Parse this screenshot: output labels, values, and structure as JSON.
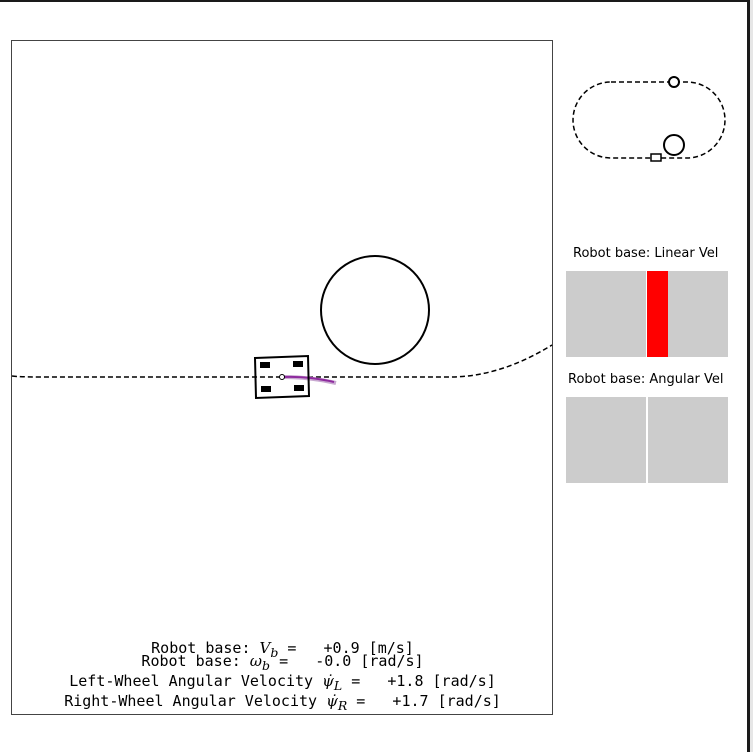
{
  "main_view": {
    "path_style": "dashed",
    "robot_trail_color": "#8e2a9e",
    "obstacle_label": ""
  },
  "mini_map": {
    "track_style": "dashed"
  },
  "gauges": {
    "linear": {
      "title": "Robot base: Linear Vel",
      "value_fraction": 0.13,
      "fill_color": "#ff0000"
    },
    "angular": {
      "title": "Robot base: Angular Vel",
      "value_fraction": 0.0,
      "fill_color": "#ff0000"
    },
    "background_color": "#cccccc"
  },
  "readouts": {
    "linear": {
      "prefix": "Robot base: ",
      "symbol": "V",
      "sub": "b",
      "value": "  +0.9 [m/s]"
    },
    "angular": {
      "prefix": "Robot base: ",
      "symbol": "ω",
      "sub": "b",
      "value": "  -0.0 [rad/s]"
    },
    "left_wheel": {
      "prefix": "Left-Wheel Angular Velocity ",
      "symbol": "ψ̇",
      "sub": "L",
      "value": "  +1.8 [rad/s]"
    },
    "right_wheel": {
      "prefix": "Right-Wheel Angular Velocity ",
      "symbol": "ψ̇",
      "sub": "R",
      "value": "  +1.7 [rad/s]"
    }
  }
}
